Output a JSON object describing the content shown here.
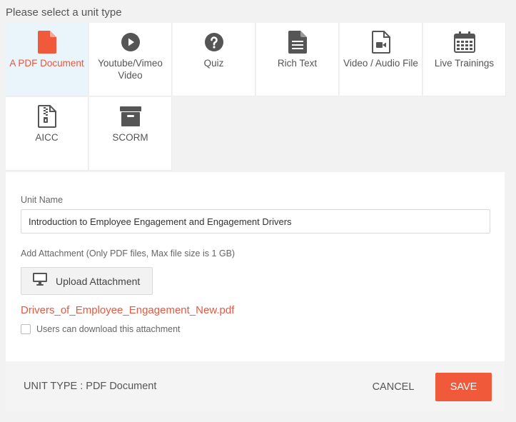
{
  "heading": "Please select a unit type",
  "unit_types": [
    {
      "label": "A PDF Document",
      "icon": "pdf-file-icon",
      "selected": true
    },
    {
      "label": "Youtube/Vimeo Video",
      "icon": "play-circle-icon",
      "selected": false
    },
    {
      "label": "Quiz",
      "icon": "question-circle-icon",
      "selected": false
    },
    {
      "label": "Rich Text",
      "icon": "text-file-icon",
      "selected": false
    },
    {
      "label": "Video / Audio File",
      "icon": "video-file-icon",
      "selected": false
    },
    {
      "label": "Live Trainings",
      "icon": "calendar-icon",
      "selected": false
    },
    {
      "label": "AICC",
      "icon": "zip-file-icon",
      "selected": false
    },
    {
      "label": "SCORM",
      "icon": "archive-box-icon",
      "selected": false
    }
  ],
  "form": {
    "unit_name_label": "Unit Name",
    "unit_name_value": "Introduction to Employee Engagement and Engagement Drivers",
    "attachment_label": "Add Attachment (Only PDF files, Max file size is 1 GB)",
    "upload_button_label": "Upload Attachment",
    "upload_icon": "monitor-icon",
    "attached_file": "Drivers_of_Employee_Engagement_New.pdf",
    "download_checkbox_label": "Users can download this attachment",
    "download_checked": false
  },
  "footer": {
    "unit_type_text": "UNIT TYPE : PDF Document",
    "cancel_label": "CANCEL",
    "save_label": "SAVE"
  },
  "colors": {
    "accent": "#f0593a",
    "selected_tile_bg": "#e9f4fb",
    "icon": "#555555"
  }
}
